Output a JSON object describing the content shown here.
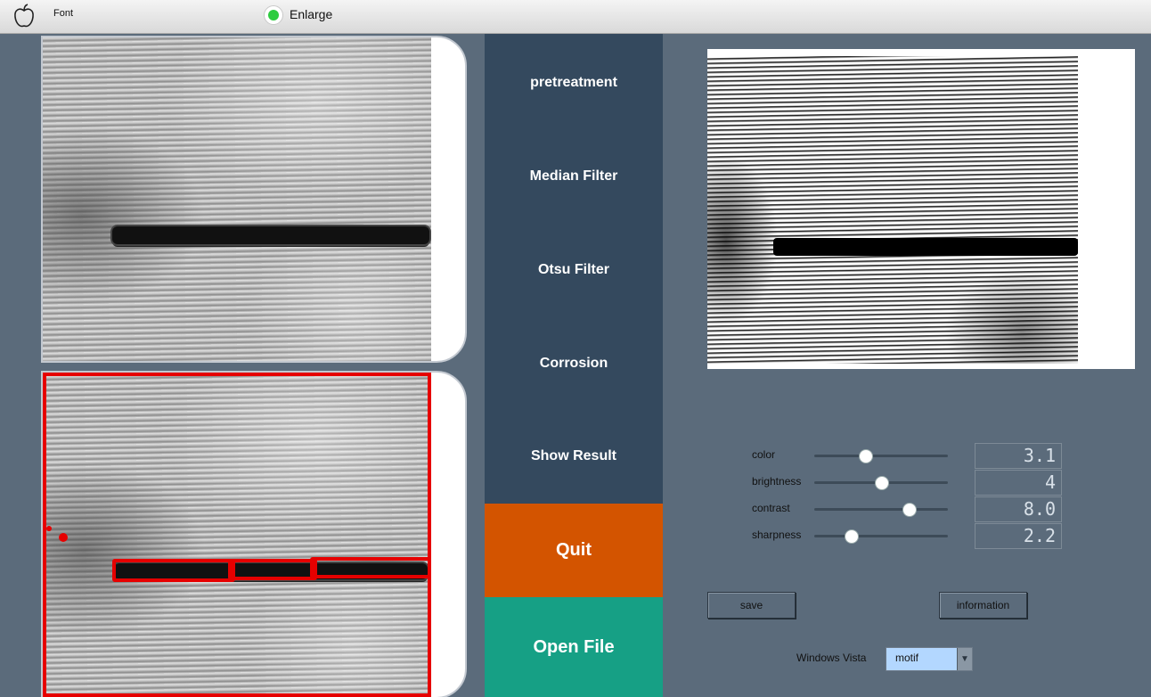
{
  "toolbar": {
    "icon": "apple-icon",
    "font_label": "Font",
    "enlarge_label": "Enlarge",
    "enlarge_led_color": "#2ecc40"
  },
  "menu": {
    "pretreatment": "pretreatment",
    "median": "Median Filter",
    "otsu": "Otsu Filter",
    "corrosion": "Corrosion",
    "show_result": "Show Result",
    "quit": "Quit",
    "open_file": "Open File",
    "colors": {
      "primary": "#34495e",
      "quit": "#d35400",
      "open": "#16a085"
    }
  },
  "sliders": [
    {
      "label": "color",
      "value": 3.1,
      "display": "3.1"
    },
    {
      "label": "brightness",
      "value": 4,
      "display": "4"
    },
    {
      "label": "contrast",
      "value": 8.0,
      "display": "8.0"
    },
    {
      "label": "sharpness",
      "value": 2.2,
      "display": "2.2"
    }
  ],
  "buttons": {
    "save": "save",
    "information": "information"
  },
  "style_select": {
    "label": "Windows Vista",
    "value": "motif"
  }
}
